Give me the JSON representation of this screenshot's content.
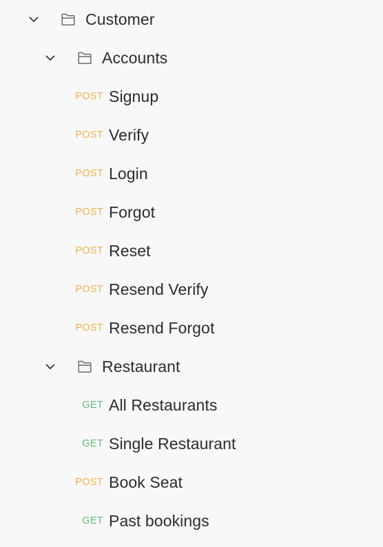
{
  "tree": {
    "root": {
      "label": "Customer",
      "icon": "folder-icon",
      "chevron": "chevron-down-icon",
      "expanded": true
    },
    "groups": [
      {
        "label": "Accounts",
        "icon": "folder-icon",
        "chevron": "chevron-down-icon",
        "expanded": true,
        "requests": [
          {
            "method": "POST",
            "label": "Signup"
          },
          {
            "method": "POST",
            "label": "Verify"
          },
          {
            "method": "POST",
            "label": "Login"
          },
          {
            "method": "POST",
            "label": "Forgot"
          },
          {
            "method": "POST",
            "label": "Reset"
          },
          {
            "method": "POST",
            "label": "Resend Verify"
          },
          {
            "method": "POST",
            "label": "Resend Forgot"
          }
        ]
      },
      {
        "label": "Restaurant",
        "icon": "folder-icon",
        "chevron": "chevron-down-icon",
        "expanded": true,
        "requests": [
          {
            "method": "GET",
            "label": "All Restaurants"
          },
          {
            "method": "GET",
            "label": "Single Restaurant"
          },
          {
            "method": "POST",
            "label": "Book Seat"
          },
          {
            "method": "GET",
            "label": "Past bookings"
          }
        ]
      }
    ]
  },
  "colors": {
    "background": "#f8f8f9",
    "text": "#2c2c2e",
    "icon_stroke": "#6b6b70",
    "chevron_stroke": "#3a3a3c",
    "method_post": "#f1b24a",
    "method_get": "#5cbf7a"
  }
}
